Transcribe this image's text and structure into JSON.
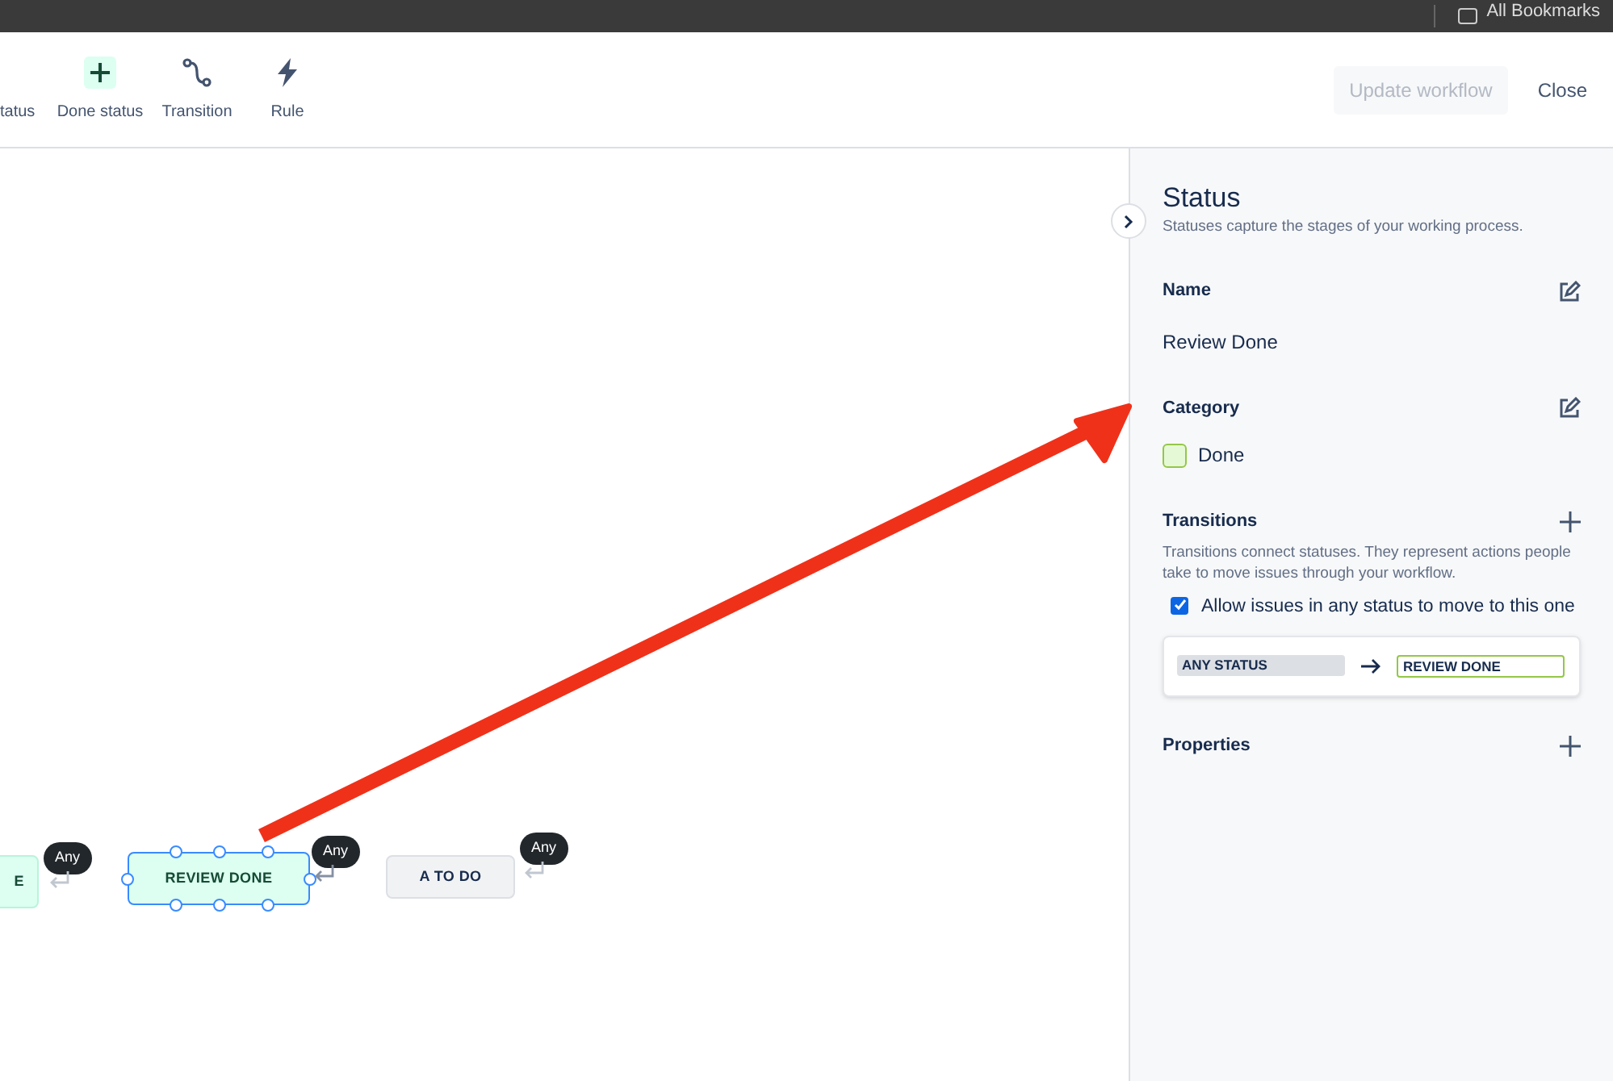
{
  "browser_bar": {
    "bookmarks_label": "All Bookmarks"
  },
  "toolbar": {
    "items": [
      {
        "kind": "status",
        "label": "tatus"
      },
      {
        "kind": "done",
        "label": "Done status"
      },
      {
        "kind": "transition",
        "label": "Transition"
      },
      {
        "kind": "rule",
        "label": "Rule"
      }
    ],
    "update_button": {
      "label": "Update workflow",
      "disabled": true
    },
    "close_button": {
      "label": "Close"
    }
  },
  "canvas": {
    "nodes": [
      {
        "label": "E",
        "kind": "done",
        "selected": false,
        "badge": "Any"
      },
      {
        "label": "REVIEW DONE",
        "kind": "done",
        "selected": true,
        "badge": "Any"
      },
      {
        "label": "A TO DO",
        "kind": "todo",
        "selected": false,
        "badge": "Any"
      }
    ]
  },
  "panel": {
    "title": "Status",
    "subtitle": "Statuses capture the stages of your working process.",
    "name": {
      "heading": "Name",
      "value": "Review Done"
    },
    "category": {
      "heading": "Category",
      "value": "Done",
      "color": "#e6f9d6"
    },
    "transitions": {
      "heading": "Transitions",
      "description": "Transitions connect statuses. They represent actions people take to move issues through your workflow.",
      "allow_any": {
        "label": "Allow issues in any status to move to this one",
        "checked": true
      },
      "from": "ANY STATUS",
      "to": "REVIEW DONE"
    },
    "properties": {
      "heading": "Properties"
    }
  }
}
